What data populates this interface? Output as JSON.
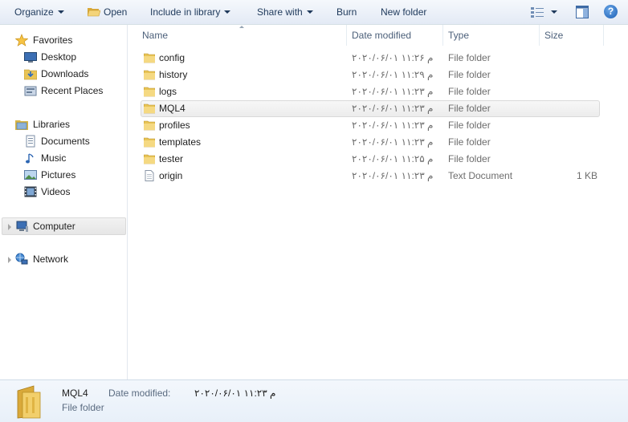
{
  "toolbar": {
    "organize": "Organize",
    "open": "Open",
    "include_in_library": "Include in library",
    "share_with": "Share with",
    "burn": "Burn",
    "new_folder": "New folder",
    "help": "?"
  },
  "nav": {
    "favorites": {
      "label": "Favorites",
      "items": [
        {
          "label": "Desktop",
          "icon": "desktop-icon"
        },
        {
          "label": "Downloads",
          "icon": "downloads-icon"
        },
        {
          "label": "Recent Places",
          "icon": "recent-places-icon"
        }
      ]
    },
    "libraries": {
      "label": "Libraries",
      "items": [
        {
          "label": "Documents",
          "icon": "documents-icon"
        },
        {
          "label": "Music",
          "icon": "music-icon"
        },
        {
          "label": "Pictures",
          "icon": "pictures-icon"
        },
        {
          "label": "Videos",
          "icon": "videos-icon"
        }
      ]
    },
    "computer": "Computer",
    "network": "Network"
  },
  "columns": {
    "name": "Name",
    "date_modified": "Date modified",
    "type": "Type",
    "size": "Size"
  },
  "files": [
    {
      "name": "config",
      "date": "۲۰۲۰/۰۶/۰۱ م ۱۱:۲۶",
      "type": "File folder",
      "size": ""
    },
    {
      "name": "history",
      "date": "۲۰۲۰/۰۶/۰۱ م ۱۱:۲۹",
      "type": "File folder",
      "size": ""
    },
    {
      "name": "logs",
      "date": "۲۰۲۰/۰۶/۰۱ م ۱۱:۲۳",
      "type": "File folder",
      "size": ""
    },
    {
      "name": "MQL4",
      "date": "۲۰۲۰/۰۶/۰۱ م ۱۱:۲۳",
      "type": "File folder",
      "size": ""
    },
    {
      "name": "profiles",
      "date": "۲۰۲۰/۰۶/۰۱ م ۱۱:۲۳",
      "type": "File folder",
      "size": ""
    },
    {
      "name": "templates",
      "date": "۲۰۲۰/۰۶/۰۱ م ۱۱:۲۳",
      "type": "File folder",
      "size": ""
    },
    {
      "name": "tester",
      "date": "۲۰۲۰/۰۶/۰۱ م ۱۱:۲۵",
      "type": "File folder",
      "size": ""
    },
    {
      "name": "origin",
      "date": "۲۰۲۰/۰۶/۰۱ م ۱۱:۲۳",
      "type": "Text Document",
      "size": "1 KB"
    }
  ],
  "details": {
    "name": "MQL4",
    "date_label": "Date modified:",
    "date_value": "۲۰۲۰/۰۶/۰۱ م ۱۱:۲۳",
    "type": "File folder"
  },
  "colors": {
    "toolbar_text": "#1e395b",
    "folder_yellow": "#e8c456",
    "selection_border": "#d9d9d9"
  }
}
